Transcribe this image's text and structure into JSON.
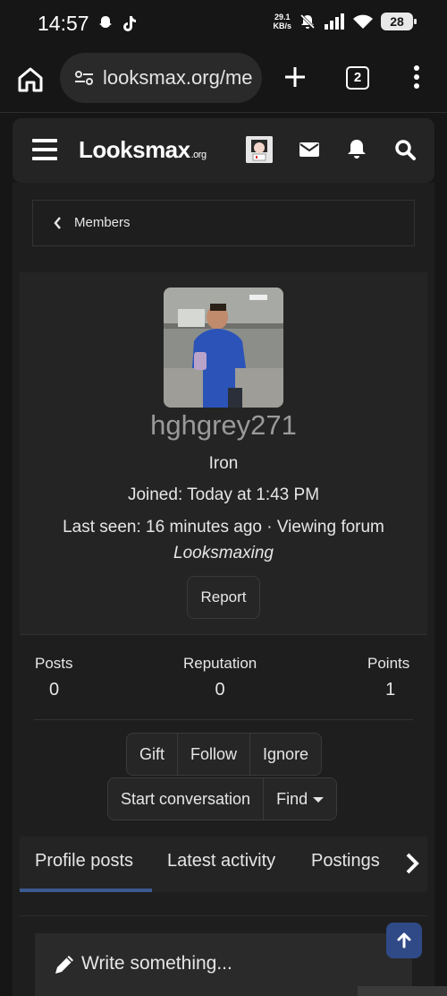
{
  "status_bar": {
    "time": "14:57",
    "net_speed_value": "29.1",
    "net_speed_unit": "KB/s",
    "battery": "28",
    "icons": [
      "snapchat-icon",
      "tiktok-icon",
      "mute-icon",
      "signal-icon",
      "wifi-icon",
      "battery-icon"
    ]
  },
  "browser": {
    "url": "looksmax.org/me",
    "tab_count": "2"
  },
  "site_nav": {
    "logo": "Looksmax",
    "logo_suffix": ".org"
  },
  "breadcrumb": {
    "label": "Members"
  },
  "profile": {
    "username": "hghgrey271",
    "rank": "Iron",
    "joined": "Joined: Today at 1:43 PM",
    "last_seen": "Last seen: 16 minutes ago · Viewing forum",
    "viewing_forum": "Looksmaxing",
    "report_label": "Report"
  },
  "stats": {
    "posts_label": "Posts",
    "posts_value": "0",
    "reputation_label": "Reputation",
    "reputation_value": "0",
    "points_label": "Points",
    "points_value": "1"
  },
  "actions": {
    "gift": "Gift",
    "follow": "Follow",
    "ignore": "Ignore",
    "start_conversation": "Start conversation",
    "find": "Find"
  },
  "tabs": {
    "profile_posts": "Profile posts",
    "latest_activity": "Latest activity",
    "postings": "Postings"
  },
  "compose": {
    "placeholder": "Write something..."
  },
  "colors": {
    "background": "#161616",
    "panel": "#242424",
    "accent": "#3b5a8f",
    "username": "#9a9a9a"
  }
}
